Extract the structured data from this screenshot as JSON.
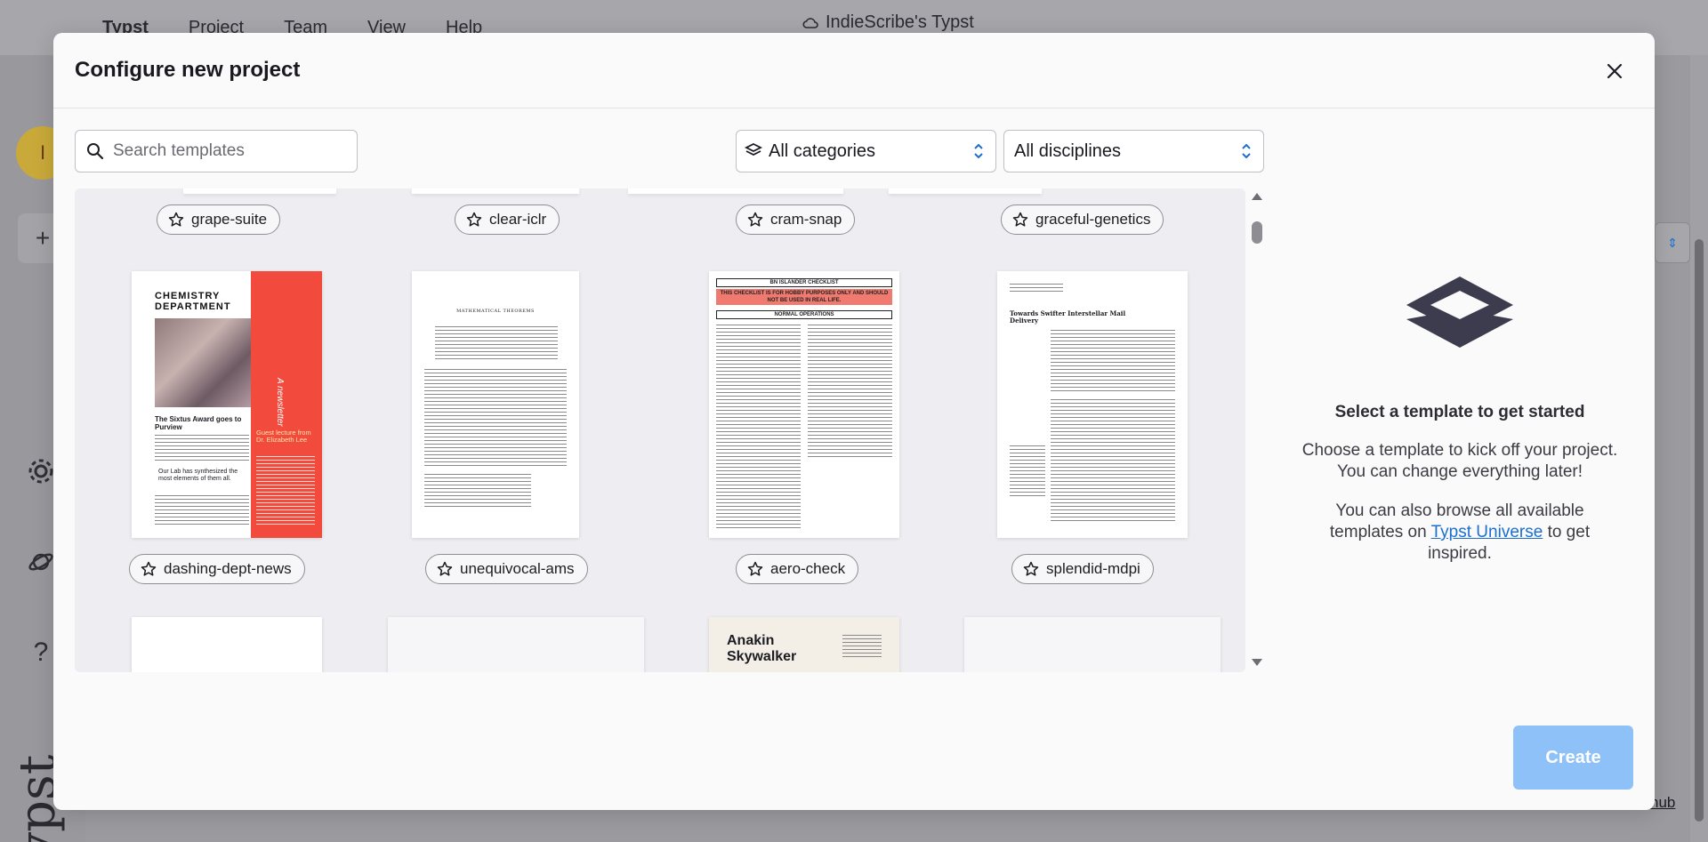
{
  "app": {
    "menu": [
      "Typst",
      "Project",
      "Team",
      "View",
      "Help"
    ],
    "window_title": "IndieScribe's Typst",
    "avatar_letter": "I",
    "plus": "+",
    "logo_text": "typst",
    "hub_link": "hub"
  },
  "modal": {
    "title": "Configure new project",
    "search_placeholder": "Search templates",
    "category_select": "All categories",
    "discipline_select": "All disciplines",
    "templates_row1": [
      "grape-suite",
      "clear-iclr",
      "cram-snap",
      "graceful-genetics"
    ],
    "templates_row2": [
      "dashing-dept-news",
      "unequivocal-ams",
      "aero-check",
      "splendid-mdpi"
    ],
    "preview_chem": {
      "title": "CHEMISTRY DEPARTMENT",
      "headline": "The Sixtus Award goes to Purview",
      "quote": "Our Lab has synthesized the most elements of them all.",
      "sidebar": "A newsletter",
      "guest": "Guest lecture from Dr. Elizabeth Lee"
    },
    "preview_ams": {
      "title": "MATHEMATICAL THEOREMS"
    },
    "preview_check": {
      "title": "BN ISLANDER CHECKLIST",
      "warning": "THIS CHECKLIST IS FOR HOBBY PURPOSES ONLY AND SHOULD NOT BE USED IN REAL LIFE.",
      "section": "NORMAL OPERATIONS"
    },
    "preview_mdpi": {
      "title": "Towards Swifter Interstellar Mail Delivery"
    },
    "preview_cv": {
      "name": "Anakin Skywalker"
    },
    "info": {
      "title": "Select a template to get started",
      "p1": "Choose a template to kick off your project. You can change everything later!",
      "p2_before": "You can also browse all available templates on",
      "p2_link": "Typst Universe",
      "p2_after": "to get inspired."
    },
    "create_label": "Create"
  }
}
